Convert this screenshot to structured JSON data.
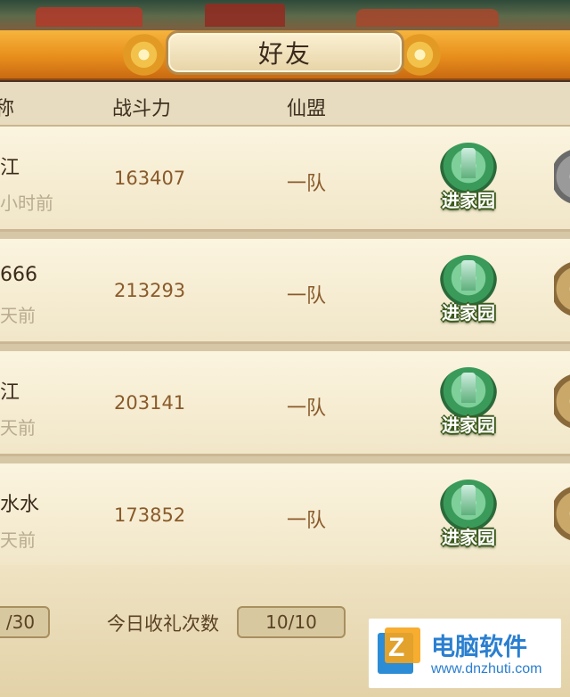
{
  "header": {
    "title": "好友"
  },
  "columns": {
    "name": "称",
    "power": "战斗力",
    "alliance": "仙盟"
  },
  "friends": [
    {
      "name": "江",
      "last_online": "小时前",
      "power": "163407",
      "alliance": "一队",
      "home_label": "进家园"
    },
    {
      "name": "666",
      "last_online": "天前",
      "power": "213293",
      "alliance": "一队",
      "home_label": "进家园"
    },
    {
      "name": "江",
      "last_online": "天前",
      "power": "203141",
      "alliance": "一队",
      "home_label": "进家园"
    },
    {
      "name": "水水",
      "last_online": "天前",
      "power": "173852",
      "alliance": "一队",
      "home_label": "进家园"
    }
  ],
  "footer": {
    "friend_count": "/30",
    "gift_label": "今日收礼次数",
    "gift_count": "10/10"
  },
  "watermark": {
    "title": "电脑软件",
    "url": "www.dnzhuti.com",
    "logo_letter": "Z"
  }
}
